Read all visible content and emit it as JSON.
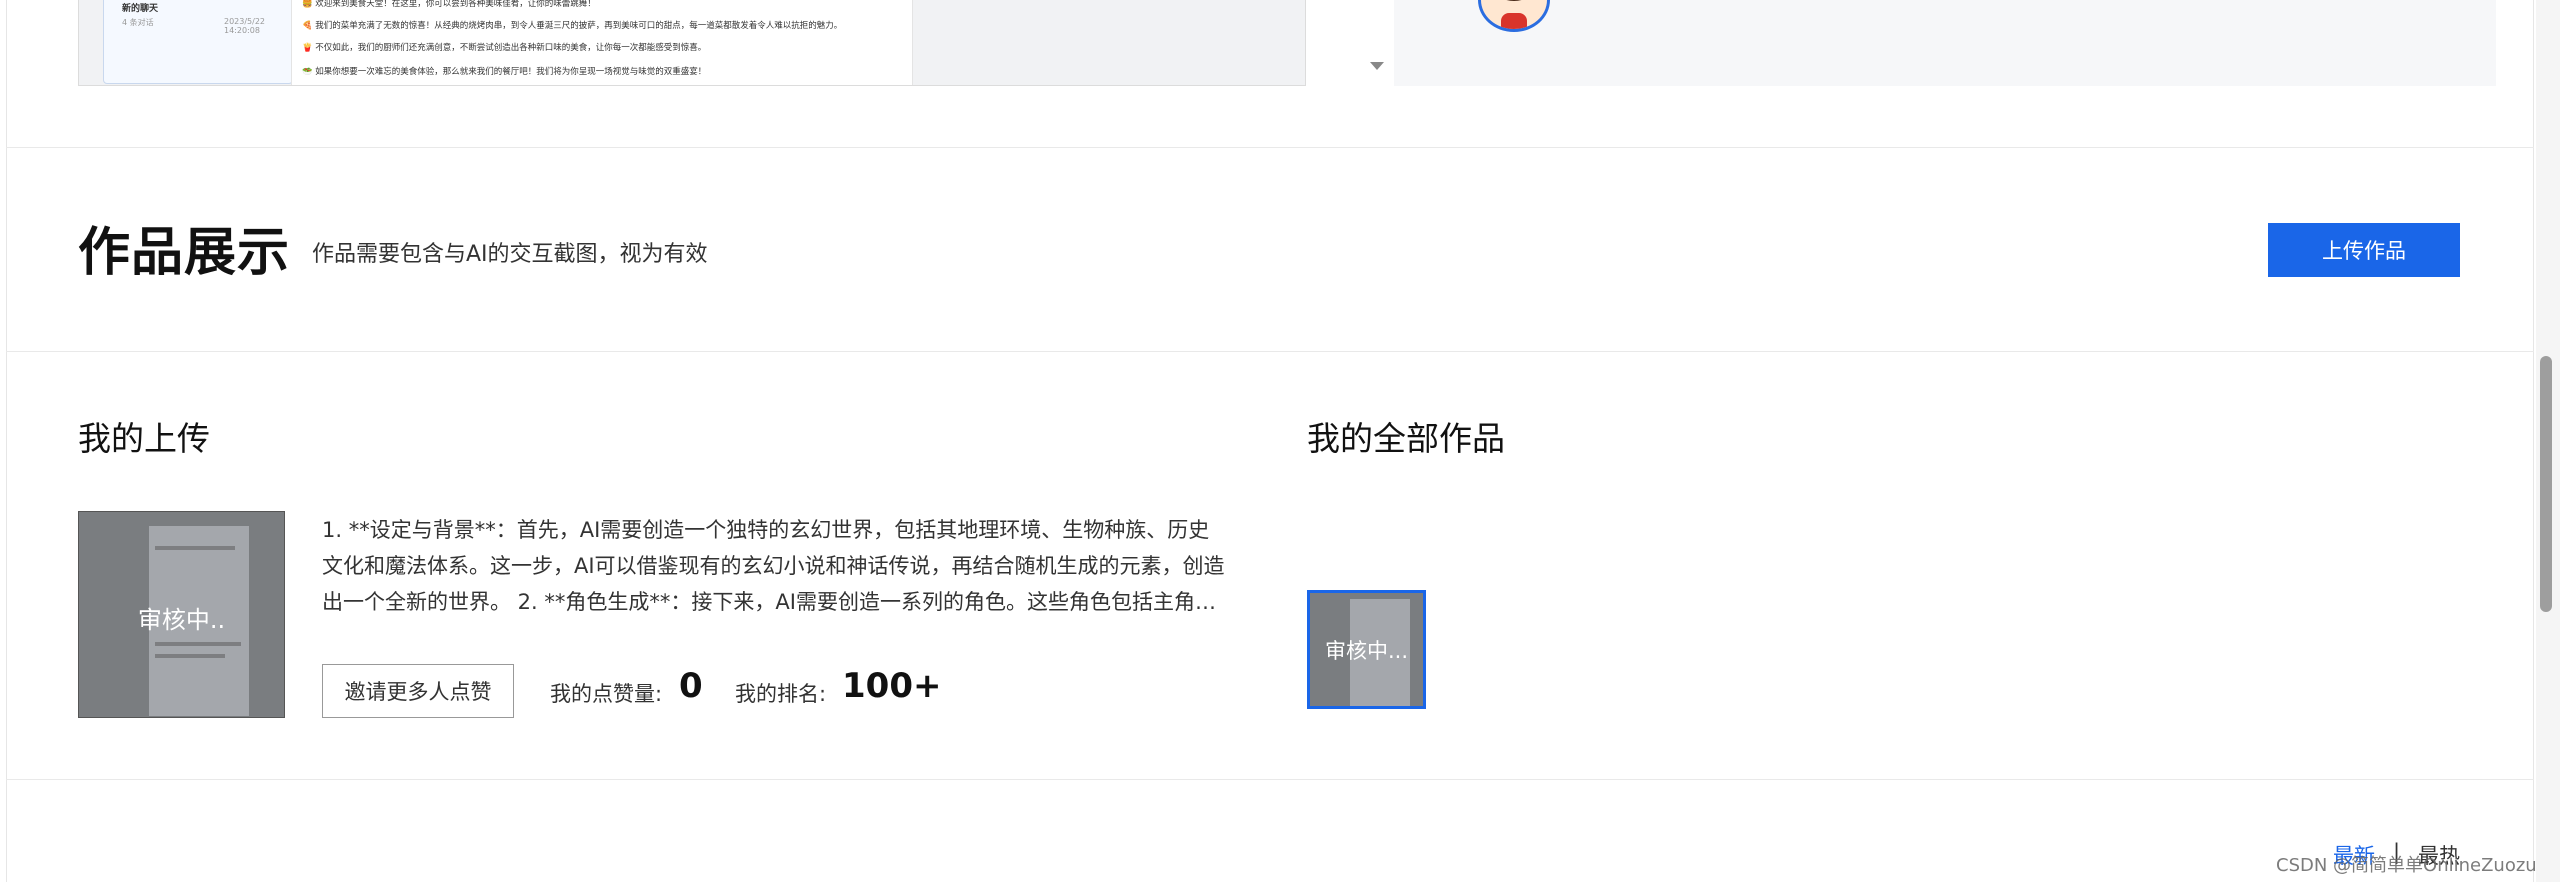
{
  "preview": {
    "card_title": "新的聊天",
    "card_meta_left": "4 条对话",
    "card_date": "2023/5/22 14:20:08",
    "chat_lines": [
      "🍔 欢迎来到美食天堂！在这里，你可以尝到各种美味佳肴，让你的味蕾跳舞！",
      "🍕 我们的菜单充满了无数的惊喜！从经典的烧烤肉串，到令人垂涎三尺的披萨，再到美味可口的甜点，每一道菜都散发着令人难以抗拒的魅力。",
      "🍟 不仅如此，我们的厨师们还充满创意，不断尝试创造出各种新口味的美食，让你每一次都能感受到惊喜。",
      "🥗 如果你想要一次难忘的美食体验，那么就来我们的餐厅吧！我们将为你呈现一场视觉与味觉的双重盛宴！"
    ]
  },
  "works": {
    "title": "作品展示",
    "subtitle": "作品需要包含与AI的交互截图，视为有效",
    "upload_button": "上传作品"
  },
  "my_uploads": {
    "heading": "我的上传",
    "thumb_status": "审核中..",
    "description": "1. **设定与背景**：首先，AI需要创造一个独特的玄幻世界，包括其地理环境、生物种族、历史文化和魔法体系。这一步，AI可以借鉴现有的玄幻小说和神话传说，再结合随机生成的元素，创造出一个全新的世界。 2. **角色生成**：接下来，AI需要创造一系列的角色。这些角色包括主角、配角和反派等。",
    "invite_button": "邀请更多人点赞",
    "likes_label": "我的点赞量:",
    "likes_value": "0",
    "rank_label": "我的排名:",
    "rank_value": "100+"
  },
  "all_works": {
    "heading": "我的全部作品",
    "thumb_status": "审核中..."
  },
  "sort": {
    "latest": "最新",
    "separator": "|",
    "hottest": "最热"
  },
  "watermark": "CSDN @简简单单OnlineZuozuo",
  "colors": {
    "accent": "#1a66e8",
    "review_overlay": "#7a7d80"
  }
}
